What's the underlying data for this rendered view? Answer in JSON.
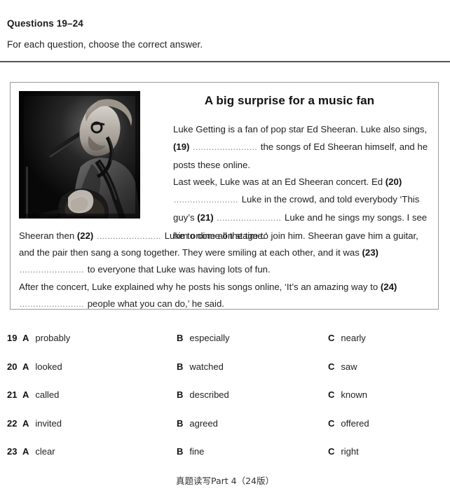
{
  "header": {
    "questions_title": "Questions 19–24",
    "instruction": "For each question, choose the correct answer."
  },
  "passage": {
    "headline": "A big surprise for a music fan",
    "photo_alt": "black-and-white photo of male singer with guitar at microphone",
    "paragraph1": {
      "part1": "Luke Getting is a fan of pop star Ed Sheeran. Luke also sings,",
      "gap": "(19)",
      "dots": "........................",
      "part2": "the songs of Ed Sheeran himself, and he posts these online."
    },
    "paragraph2": {
      "part1": "Last week, Luke was at an Ed Sheeran concert. Ed",
      "gap1": "(20)",
      "dots1": "........................",
      "part2": "Luke in the crowd, and told everybody ‘This guy’s",
      "gap2": "(21)",
      "dots2": "........................",
      "part3": "Luke and he sings my songs. I see him online all the time.’"
    },
    "paragraph3": {
      "part1": "Sheeran then",
      "gap1": "(22)",
      "dots1": "........................",
      "part2": "Luke to come on stage to join him. Sheeran gave him a guitar, and the pair then sang a song together. They were smiling at each other, and it was",
      "gap2": "(23)",
      "dots2": "........................",
      "part3": "to everyone that Luke was having lots of fun."
    },
    "paragraph4": {
      "part1": "After the concert, Luke explained why he posts his songs online, ‘It’s an amazing way to",
      "gap": "(24)",
      "dots": "........................",
      "part2": "people what you can do,’ he said."
    }
  },
  "options": {
    "rows": [
      {
        "number": "19",
        "a_letter": "A",
        "a_text": "probably",
        "b_letter": "B",
        "b_text": "especially",
        "c_letter": "C",
        "c_text": "nearly"
      },
      {
        "number": "20",
        "a_letter": "A",
        "a_text": "looked",
        "b_letter": "B",
        "b_text": "watched",
        "c_letter": "C",
        "c_text": "saw"
      },
      {
        "number": "21",
        "a_letter": "A",
        "a_text": "called",
        "b_letter": "B",
        "b_text": "described",
        "c_letter": "C",
        "c_text": "known"
      },
      {
        "number": "22",
        "a_letter": "A",
        "a_text": "invited",
        "b_letter": "B",
        "b_text": "agreed",
        "c_letter": "C",
        "c_text": "offered"
      },
      {
        "number": "23",
        "a_letter": "A",
        "a_text": "clear",
        "b_letter": "B",
        "b_text": "fine",
        "c_letter": "C",
        "c_text": "right"
      }
    ]
  },
  "footer": {
    "text": "真题读写Part 4（24版）"
  },
  "colors": {
    "text": "#222222",
    "rule": "#555555",
    "box_border": "#9a9a9a",
    "dots": "#777777"
  }
}
